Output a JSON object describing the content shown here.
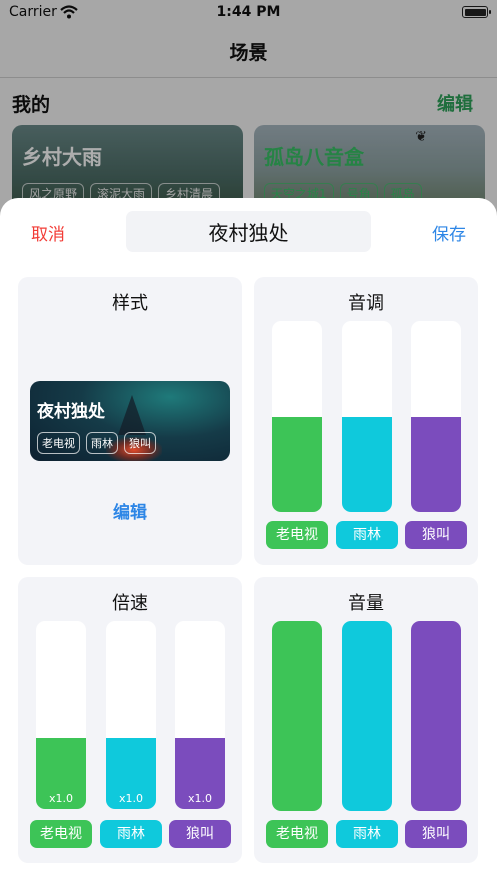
{
  "status_bar": {
    "carrier": "Carrier",
    "time": "1:44 PM"
  },
  "nav": {
    "title": "场景"
  },
  "mine": {
    "title": "我的",
    "edit_label": "编辑",
    "cards": [
      {
        "name": "乡村大雨",
        "tags": [
          "风之原野",
          "滚泥大雨",
          "乡村清晨"
        ]
      },
      {
        "name": "孤岛八音盒",
        "tags": [
          "天空之城1",
          "号角",
          "孤岛"
        ]
      }
    ]
  },
  "sheet": {
    "cancel_label": "取消",
    "save_label": "保存",
    "name_value": "夜村独处"
  },
  "style_panel": {
    "title": "样式",
    "preview_name": "夜村独处",
    "preview_tags": [
      "老电视",
      "雨林",
      "狼叫"
    ],
    "edit_label": "编辑"
  },
  "colors": {
    "green": "#3dc457",
    "cyan": "#0fc9dc",
    "purple": "#7b4cbd",
    "cancel": "#f23c36",
    "accent": "#2d86e6"
  },
  "tone_panel": {
    "title": "音调",
    "tracks": [
      {
        "name": "老电视",
        "level": 0.5,
        "color": "#3dc457"
      },
      {
        "name": "雨林",
        "level": 0.5,
        "color": "#0fc9dc"
      },
      {
        "name": "狼叫",
        "level": 0.5,
        "color": "#7b4cbd"
      }
    ]
  },
  "speed_panel": {
    "title": "倍速",
    "tracks": [
      {
        "name": "老电视",
        "level": 0.38,
        "value_label": "x1.0",
        "color": "#3dc457"
      },
      {
        "name": "雨林",
        "level": 0.38,
        "value_label": "x1.0",
        "color": "#0fc9dc"
      },
      {
        "name": "狼叫",
        "level": 0.38,
        "value_label": "x1.0",
        "color": "#7b4cbd"
      }
    ]
  },
  "volume_panel": {
    "title": "音量",
    "tracks": [
      {
        "name": "老电视",
        "level": 1.0,
        "color": "#3dc457"
      },
      {
        "name": "雨林",
        "level": 1.0,
        "color": "#0fc9dc"
      },
      {
        "name": "狼叫",
        "level": 1.0,
        "color": "#7b4cbd"
      }
    ]
  }
}
